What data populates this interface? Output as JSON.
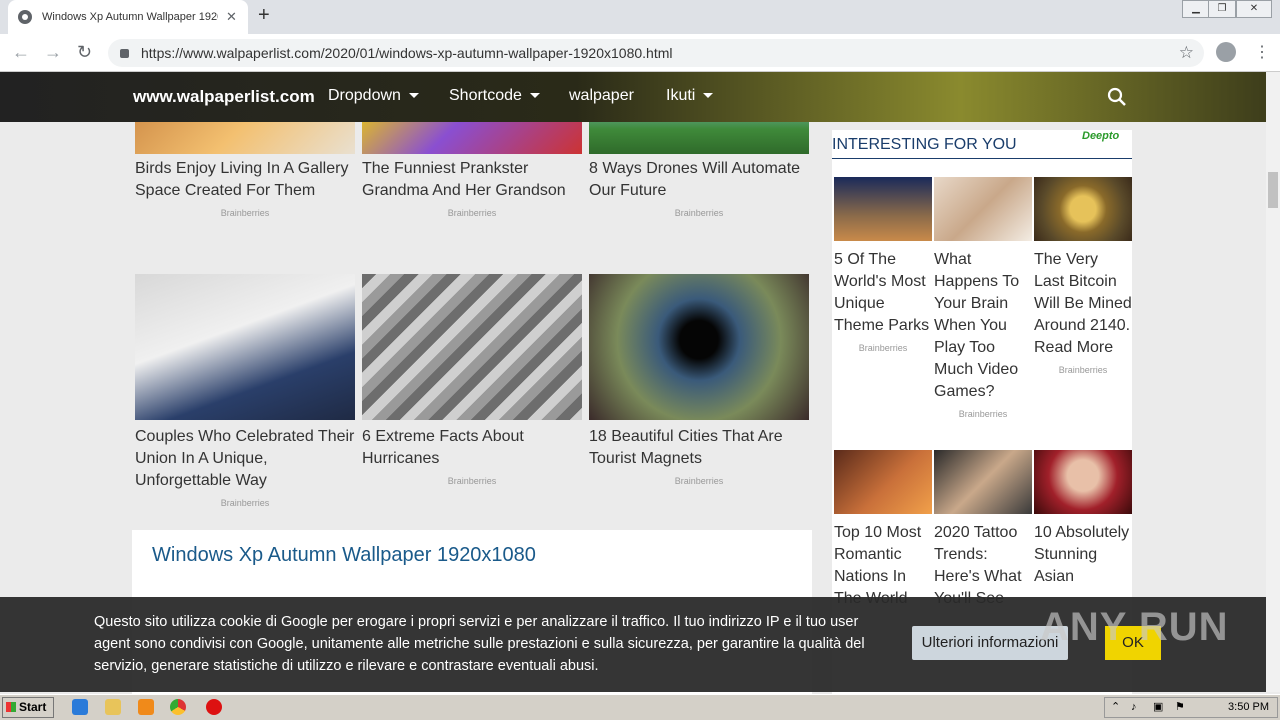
{
  "browser": {
    "tab_title": "Windows Xp Autumn Wallpaper 1920",
    "tab_close": "✕",
    "new_tab": "+",
    "url": "https://www.walpaperlist.com/2020/01/windows-xp-autumn-wallpaper-1920x1080.html"
  },
  "header": {
    "site": "www.walpaperlist.com",
    "menu": [
      {
        "label": "Dropdown",
        "caret": true
      },
      {
        "label": "Shortcode",
        "caret": true
      },
      {
        "label": "walpaper",
        "caret": false
      },
      {
        "label": "Ikuti",
        "caret": true
      }
    ]
  },
  "top_cards": [
    {
      "title": "Birds Enjoy Living In A Gallery Space Created For Them",
      "source": "Brainberries"
    },
    {
      "title": "The Funniest Prankster Grandma And Her Grandson",
      "source": "Brainberries"
    },
    {
      "title": "8 Ways Drones Will Automate Our Future",
      "source": "Brainberries"
    }
  ],
  "mid_cards": [
    {
      "title": "Couples Who Celebrated Their Union In A Unique, Unforgettable Way",
      "source": "Brainberries"
    },
    {
      "title": "6 Extreme Facts About Hurricanes",
      "source": "Brainberries"
    },
    {
      "title": "18 Beautiful Cities That Are Tourist Magnets",
      "source": "Brainberries"
    }
  ],
  "post_title": "Windows Xp Autumn Wallpaper 1920x1080",
  "sidebar": {
    "heading": "INTERESTING FOR YOU",
    "logo": "Deepto",
    "row1": [
      {
        "title": "5 Of The World's Most Unique Theme Parks",
        "source": "Brainberries"
      },
      {
        "title": "What Happens To Your Brain When You Play Too Much Video Games?",
        "source": "Brainberries"
      },
      {
        "title": "The Very Last Bitcoin Will Be Mined Around 2140. Read More",
        "source": "Brainberries"
      }
    ],
    "row2": [
      {
        "title": "Top 10 Most Romantic Nations In The World"
      },
      {
        "title": "2020 Tattoo Trends: Here's What You'll See"
      },
      {
        "title": "10 Absolutely Stunning Asian"
      }
    ]
  },
  "cookie": {
    "text": "Questo sito utilizza cookie di Google per erogare i propri servizi e per analizzare il traffico. Il tuo indirizzo IP e il tuo user agent sono condivisi con Google, unitamente alle metriche sulle prestazioni e sulla sicurezza, per garantire la qualità del servizio, generare statistiche di utilizzo e rilevare e contrastare eventuali abusi.",
    "more": "Ulteriori informazioni",
    "ok": "OK"
  },
  "watermark": "ANY RUN",
  "taskbar": {
    "start": "Start",
    "clock": "3:50 PM"
  }
}
